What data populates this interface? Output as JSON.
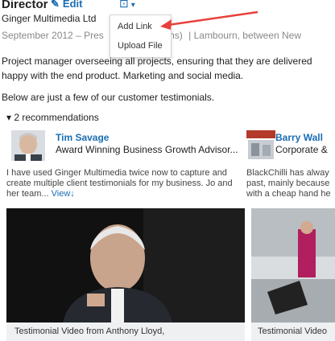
{
  "position": {
    "title": "Director",
    "edit_label": "Edit",
    "company": "Ginger Multimedia Ltd",
    "dates": "September 2012 – Pres",
    "duration": "months)",
    "location": "| Lambourn, between New"
  },
  "add_menu": {
    "items": [
      "Add Link",
      "Upload File"
    ]
  },
  "description": {
    "line1": "Project manager overseeing all projects, ensuring that they are delivered",
    "line2": "happy with the end product. Marketing and social media.",
    "line3": "Below are just a few of our customer testimonials."
  },
  "recommendations": {
    "toggle": "▾ 2 recommendations",
    "items": [
      {
        "name": "Tim Savage",
        "headline": "Award Winning Business Growth Advisor...",
        "text": "I have used Ginger Multimedia twice now to capture and create multiple client testimonials for my business. Jo and her team...",
        "view": "View↓"
      },
      {
        "name": "Barry Wall",
        "headline": "Corporate &",
        "text": "BlackChilli has alway past, mainly because with a cheap hand he"
      }
    ]
  },
  "media": {
    "items": [
      {
        "caption": "Testimonial Video from Anthony Lloyd,"
      },
      {
        "caption": "Testimonial Video"
      }
    ]
  },
  "colors": {
    "link": "#1a6db3",
    "accent_arrow": "#e8403a"
  }
}
